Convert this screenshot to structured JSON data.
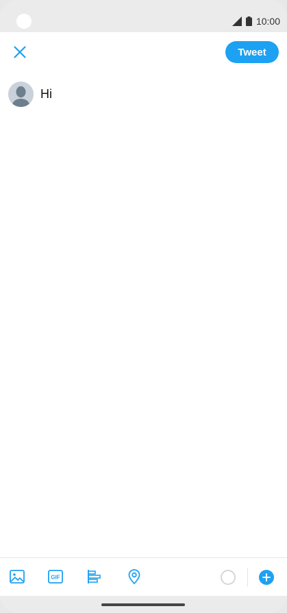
{
  "status_bar": {
    "time": "10:00",
    "icons": [
      "signal-icon",
      "battery-icon"
    ]
  },
  "header": {
    "close_icon": "close-icon",
    "tweet_button_label": "Tweet"
  },
  "compose": {
    "avatar_icon": "default-avatar-icon",
    "text": "Hi"
  },
  "toolbar": {
    "tools": [
      "image-icon",
      "gif-icon",
      "poll-icon",
      "location-icon"
    ],
    "gif_label": "GIF",
    "progress_icon": "character-count-ring",
    "add_icon": "add-thread-icon"
  },
  "colors": {
    "accent": "#1da1f2",
    "status_bar_bg": "#ebebeb"
  }
}
